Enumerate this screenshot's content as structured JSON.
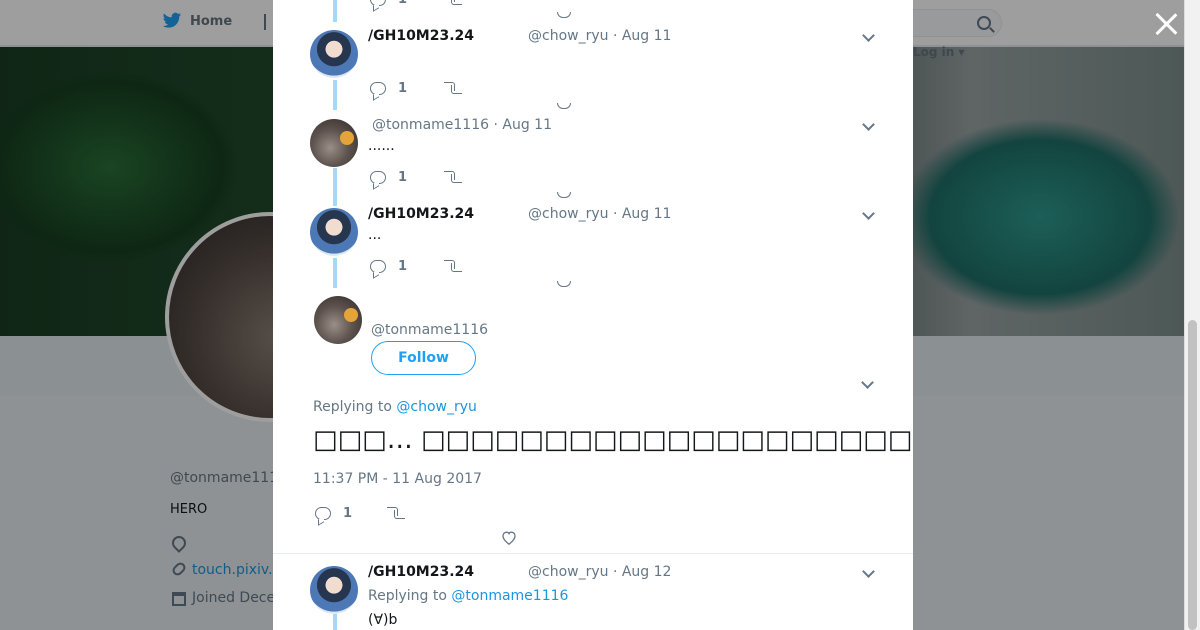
{
  "topbar": {
    "home_label": "Home",
    "login_label": "Log in ▾"
  },
  "profile": {
    "name": "",
    "handle": "@tonmame111",
    "bio": "HERO",
    "link": "touch.pixiv.",
    "joined": "Joined Dece"
  },
  "thread": [
    {
      "name": "/GH10M23.24",
      "handle": "@chow_ryu",
      "sep": "·",
      "date": "Aug 11",
      "text": "",
      "replies": "1"
    },
    {
      "name": "",
      "handle": "@tonmame1116",
      "sep": "·",
      "date": "Aug 11",
      "text": "......",
      "replies": "1"
    },
    {
      "name": "/GH10M23.24",
      "handle": "@chow_ryu",
      "sep": "·",
      "date": "Aug 11",
      "text": "...",
      "replies": "1"
    }
  ],
  "partial_top": {
    "replies": "1"
  },
  "main_tweet": {
    "handle": "@tonmame1116",
    "follow_label": "Follow",
    "replying_prefix": "Replying to",
    "replying_to": "@chow_ryu",
    "text": "□□□…  □□□□□□□□□□□□□□□□□□□□□□□□□□□□□□□□□□□(*´ω□*)",
    "timestamp": "11:37 PM - 11 Aug 2017",
    "replies": "1"
  },
  "next_tweet": {
    "name": "/GH10M23.24",
    "handle": "@chow_ryu",
    "sep": "·",
    "date": "Aug 12",
    "replying_prefix": "Replying to",
    "replying_to": "@tonmame1116",
    "text": "(∀)b"
  },
  "colors": {
    "accent": "#1da1f2",
    "thread_line": "#a4d9f5",
    "muted": "#657786"
  }
}
